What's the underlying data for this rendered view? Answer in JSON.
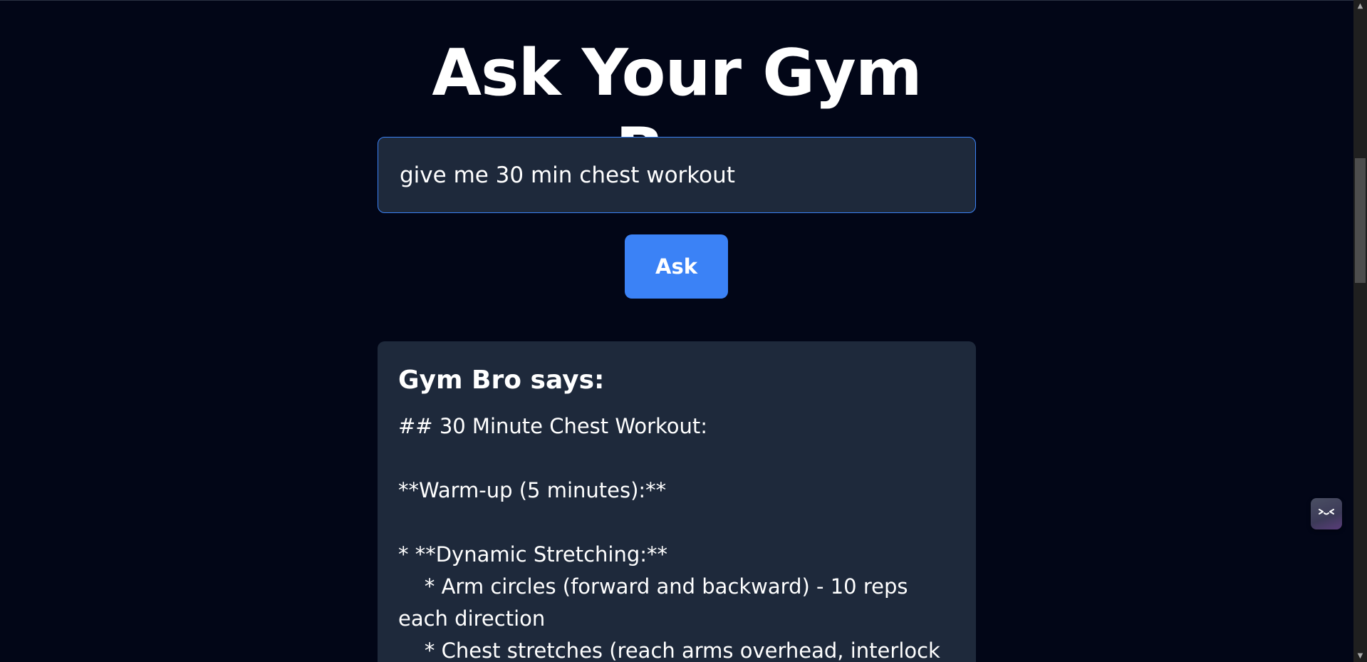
{
  "page": {
    "title": "Ask Your Gym Bro"
  },
  "query": {
    "value": "give me 30 min chest workout"
  },
  "ask_button": {
    "label": "Ask"
  },
  "response": {
    "heading": "Gym Bro says:",
    "body": "## 30 Minute Chest Workout:\n\n**Warm-up (5 minutes):**\n\n* **Dynamic Stretching:**\n    * Arm circles (forward and backward) - 10 reps each direction\n    * Chest stretches (reach arms overhead, interlock"
  },
  "icons": {
    "scroll_up": "scroll-up-arrow-icon",
    "scroll_down": "scroll-down-arrow-icon",
    "extension": "kaomoji-face-icon"
  },
  "colors": {
    "background": "#020617",
    "card": "#1e293b",
    "accent": "#3b82f6",
    "text": "#ffffff"
  }
}
